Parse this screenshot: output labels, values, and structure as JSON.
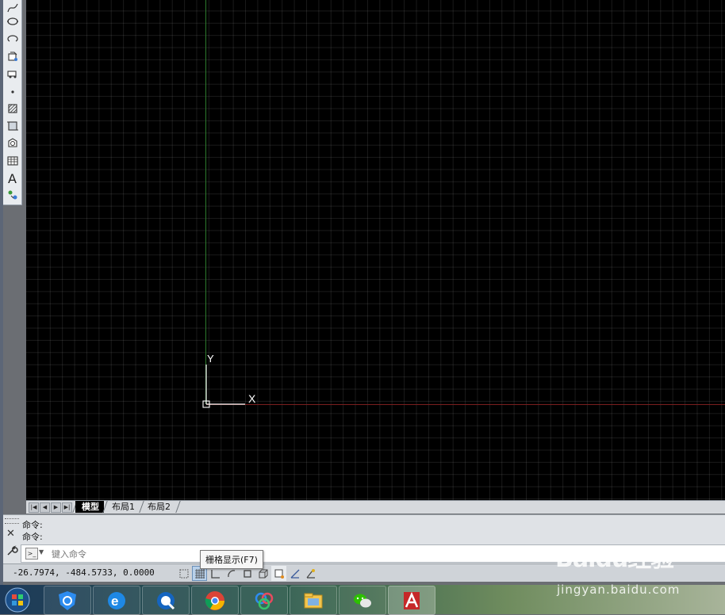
{
  "toolbar": {
    "tools": [
      {
        "icon": "spline-icon"
      },
      {
        "icon": "ellipse-icon"
      },
      {
        "icon": "ellipse-arc-icon"
      },
      {
        "icon": "insert-block-icon"
      },
      {
        "icon": "make-block-icon"
      },
      {
        "icon": "point-icon"
      },
      {
        "icon": "hatch-icon"
      },
      {
        "icon": "gradient-icon"
      },
      {
        "icon": "region-icon"
      },
      {
        "icon": "table-icon"
      },
      {
        "icon": "multiline-text-icon",
        "glyph": "A"
      },
      {
        "icon": "add-selected-icon"
      }
    ]
  },
  "ucs": {
    "y_label": "Y",
    "x_label": "X"
  },
  "tabs": {
    "model": "模型",
    "layout1": "布局1",
    "layout2": "布局2"
  },
  "command": {
    "history": [
      "命令:",
      "命令:"
    ],
    "placeholder": "键入命令"
  },
  "status": {
    "coordinates": "-26.7974,  -484.5733, 0.0000",
    "buttons": [
      "infer-constraints-icon",
      "grid-icon",
      "ortho-icon",
      "polar-icon",
      "osnap-icon",
      "3d-osnap-icon",
      "otrack-icon",
      "dynamic-ucs-icon"
    ]
  },
  "tooltip": "栅格显示(F7)",
  "taskbar": {
    "apps": [
      "security-app-icon",
      "ie-browser-icon",
      "qq-browser-icon",
      "chrome-icon",
      "baidu-netdisk-icon",
      "file-explorer-icon",
      "wechat-icon",
      "autocad-icon"
    ]
  },
  "watermark": {
    "logo": "Baidu经验",
    "url": "jingyan.baidu.com"
  }
}
